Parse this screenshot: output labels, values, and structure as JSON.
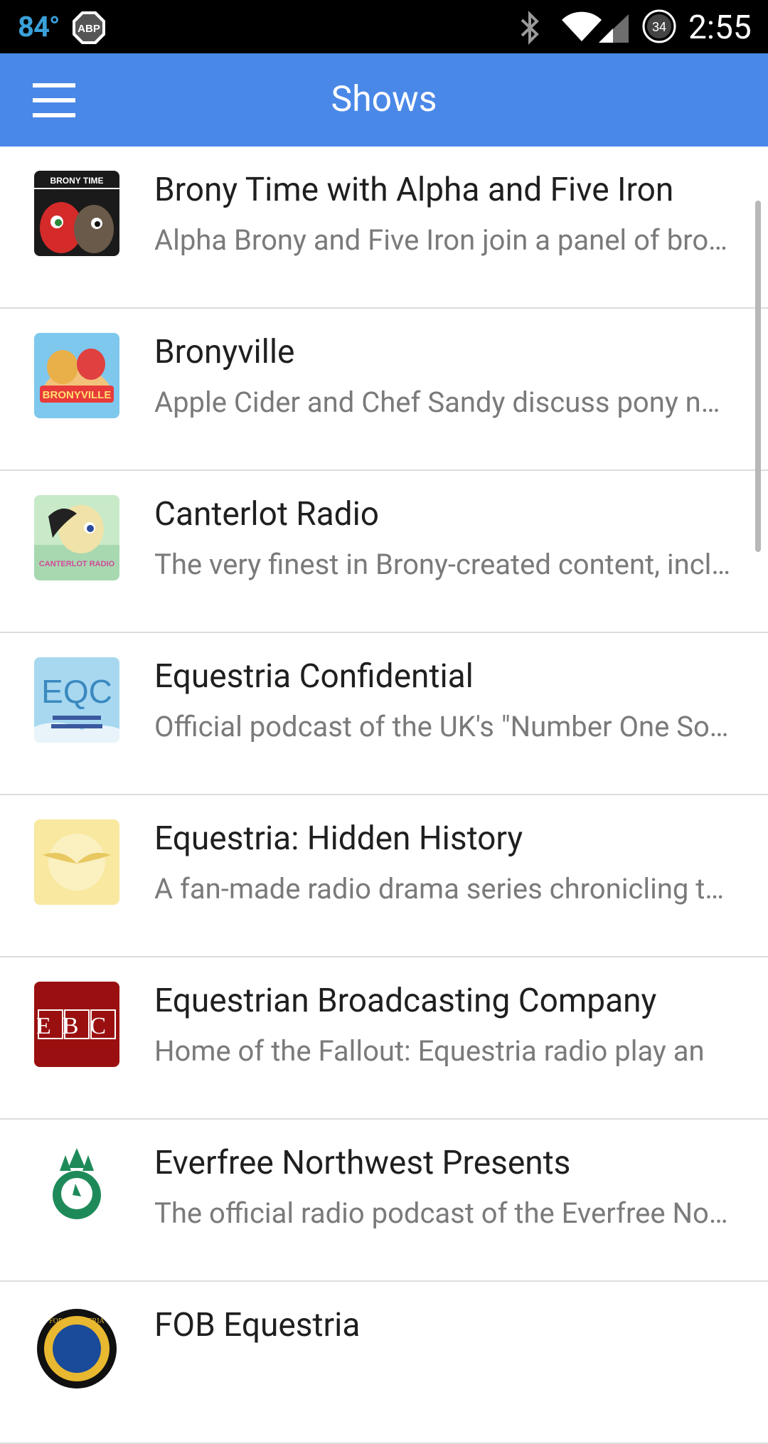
{
  "status_bar": {
    "temperature": "84°",
    "adblock_label": "ABP",
    "battery_level": "34",
    "time": "2:55",
    "icons": [
      "bluetooth-icon",
      "wifi-icon",
      "signal-icon",
      "battery-icon"
    ]
  },
  "app_bar": {
    "title": "Shows",
    "menu_icon": "hamburger-menu-icon",
    "color": "#4a88e8"
  },
  "shows": [
    {
      "title": "Brony Time with Alpha and Five Iron",
      "description": "Alpha Brony and Five Iron join a panel of brony guests",
      "thumb_caption": "BRONY TIME"
    },
    {
      "title": "Bronyville",
      "description": "Apple Cider and Chef Sandy discuss pony news",
      "thumb_caption": "BRONYVILLE"
    },
    {
      "title": "Canterlot Radio",
      "description": "The very finest in Brony-created content, including",
      "thumb_caption": "CANTERLOT RADIO"
    },
    {
      "title": "Equestria Confidential",
      "description": "Official podcast of the UK's \"Number One Source\"",
      "thumb_caption": "EQC"
    },
    {
      "title": "Equestria: Hidden History",
      "description": "A fan-made radio drama series chronicling the",
      "thumb_caption": ""
    },
    {
      "title": "Equestrian Broadcasting Company",
      "description": "Home of the Fallout: Equestria radio play an",
      "thumb_caption": "EBC"
    },
    {
      "title": "Everfree Northwest Presents",
      "description": "The official radio podcast of the Everfree Northwest",
      "thumb_caption": ""
    },
    {
      "title": "FOB Equestria",
      "description": "",
      "thumb_caption": "FOR EQUESTRIA"
    }
  ]
}
